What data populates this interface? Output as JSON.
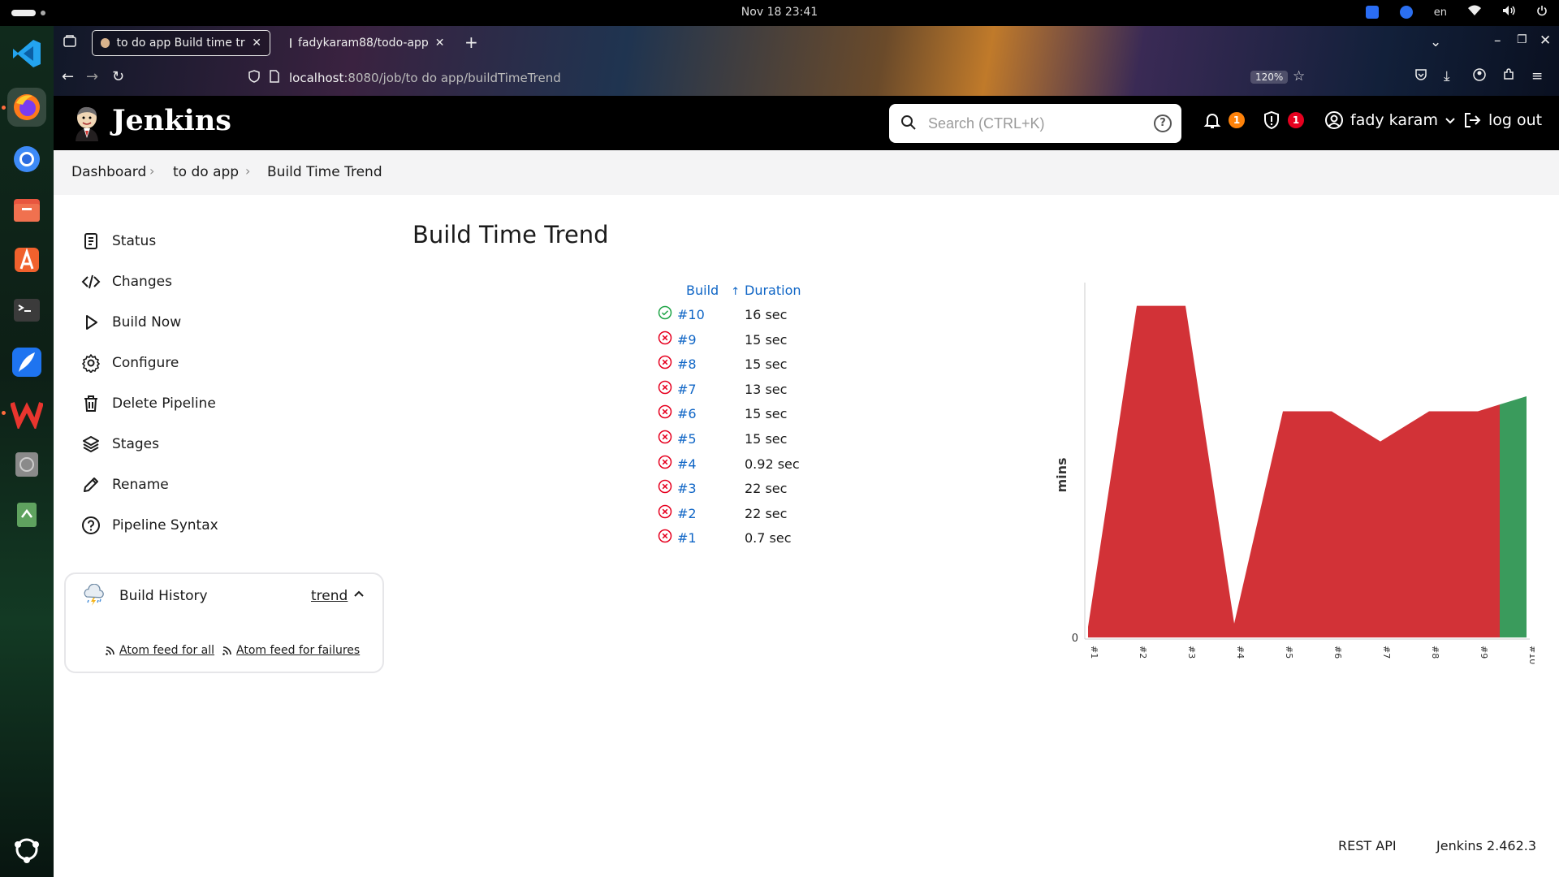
{
  "os": {
    "clock": "Nov 18  23:41",
    "lang": "en"
  },
  "browser": {
    "tabs": [
      {
        "title": "to do app Build time tre"
      },
      {
        "title": "fadykaram88/todo-app"
      }
    ],
    "url_host": "localhost",
    "url_rest": ":8080/job/to do app/buildTimeTrend",
    "zoom": "120%"
  },
  "header": {
    "brand": "Jenkins",
    "search_placeholder": "Search (CTRL+K)",
    "notifications_count": "1",
    "security_count": "1",
    "user": "fady karam",
    "logout": "log out",
    "colors": {
      "notif_badge": "#fe820a",
      "security_badge": "#e6001f"
    }
  },
  "breadcrumbs": [
    "Dashboard",
    "to do app",
    "Build Time Trend"
  ],
  "sidebar": {
    "items": [
      {
        "label": "Status",
        "icon": "document-icon"
      },
      {
        "label": "Changes",
        "icon": "code-icon"
      },
      {
        "label": "Build Now",
        "icon": "play-icon"
      },
      {
        "label": "Configure",
        "icon": "gear-icon"
      },
      {
        "label": "Delete Pipeline",
        "icon": "trash-icon"
      },
      {
        "label": "Stages",
        "icon": "layers-icon"
      },
      {
        "label": "Rename",
        "icon": "pencil-icon"
      },
      {
        "label": "Pipeline Syntax",
        "icon": "help-icon"
      }
    ],
    "history": {
      "title": "Build History",
      "trend": "trend",
      "feed_all": "Atom feed for all",
      "feed_failures": "Atom feed for failures"
    }
  },
  "main": {
    "title": "Build Time Trend",
    "table": {
      "headers": {
        "build": "Build",
        "sort": "↑",
        "duration": "Duration"
      },
      "rows": [
        {
          "build": "#10",
          "duration": "16 sec",
          "status": "success"
        },
        {
          "build": "#9",
          "duration": "15 sec",
          "status": "failure"
        },
        {
          "build": "#8",
          "duration": "15 sec",
          "status": "failure"
        },
        {
          "build": "#7",
          "duration": "13 sec",
          "status": "failure"
        },
        {
          "build": "#6",
          "duration": "15 sec",
          "status": "failure"
        },
        {
          "build": "#5",
          "duration": "15 sec",
          "status": "failure"
        },
        {
          "build": "#4",
          "duration": "0.92 sec",
          "status": "failure"
        },
        {
          "build": "#3",
          "duration": "22 sec",
          "status": "failure"
        },
        {
          "build": "#2",
          "duration": "22 sec",
          "status": "failure"
        },
        {
          "build": "#1",
          "duration": "0.7 sec",
          "status": "failure"
        }
      ]
    }
  },
  "chart_data": {
    "type": "area",
    "x": [
      "#1",
      "#2",
      "#3",
      "#4",
      "#5",
      "#6",
      "#7",
      "#8",
      "#9",
      "#10"
    ],
    "series": [
      {
        "values_sec": [
          0.7,
          22,
          22,
          0.92,
          15,
          15,
          13,
          15,
          15,
          16
        ]
      }
    ],
    "ylabel": "mins",
    "ytick_labels": [
      "0"
    ],
    "colors": {
      "failure": "#d23237",
      "success": "#3a9b5c"
    }
  },
  "footer": {
    "rest_api": "REST API",
    "version": "Jenkins 2.462.3"
  }
}
